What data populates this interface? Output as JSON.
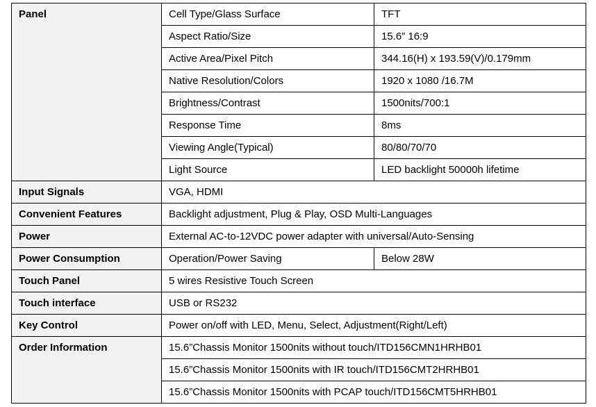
{
  "panel": {
    "label": "Panel",
    "rows": [
      {
        "name": "Cell Type/Glass Surface",
        "value": "TFT"
      },
      {
        "name": "Aspect Ratio/Size",
        "value": "15.6” 16:9"
      },
      {
        "name": "Active Area/Pixel Pitch",
        "value": "344.16(H) x 193.59(V)/0.179mm"
      },
      {
        "name": "Native Resolution/Colors",
        "value": "1920 x 1080 /16.7M"
      },
      {
        "name": "Brightness/Contrast",
        "value": "1500nits/700:1"
      },
      {
        "name": "Response Time",
        "value": "8ms"
      },
      {
        "name": "Viewing Angle(Typical)",
        "value": "80/80/70/70"
      },
      {
        "name": "Light Source",
        "value": "LED backlight 50000h lifetime"
      }
    ]
  },
  "input_signals": {
    "label": "Input Signals",
    "value": "VGA, HDMI"
  },
  "convenient_features": {
    "label": "Convenient Features",
    "value": "Backlight adjustment, Plug & Play, OSD Multi-Languages"
  },
  "power": {
    "label": "Power",
    "value": "External AC-to-12VDC power adapter with universal/Auto-Sensing"
  },
  "power_consumption": {
    "label": "Power Consumption",
    "name": "Operation/Power Saving",
    "value": "Below 28W"
  },
  "touch_panel": {
    "label": "Touch Panel",
    "value": "5 wires Resistive Touch Screen"
  },
  "touch_interface": {
    "label": "Touch interface",
    "value": "USB or RS232"
  },
  "key_control": {
    "label": "Key Control",
    "value": "Power on/off with LED, Menu, Select, Adjustment(Right/Left)"
  },
  "order_information": {
    "label": "Order Information",
    "items": [
      "15.6”Chassis Monitor 1500nits without touch/ITD156CMN1HRHB01",
      "15.6”Chassis Monitor 1500nits with IR touch/ITD156CMT2HRHB01",
      "15.6”Chassis Monitor 1500nits with PCAP touch/ITD156CMT5HRHB01"
    ]
  }
}
